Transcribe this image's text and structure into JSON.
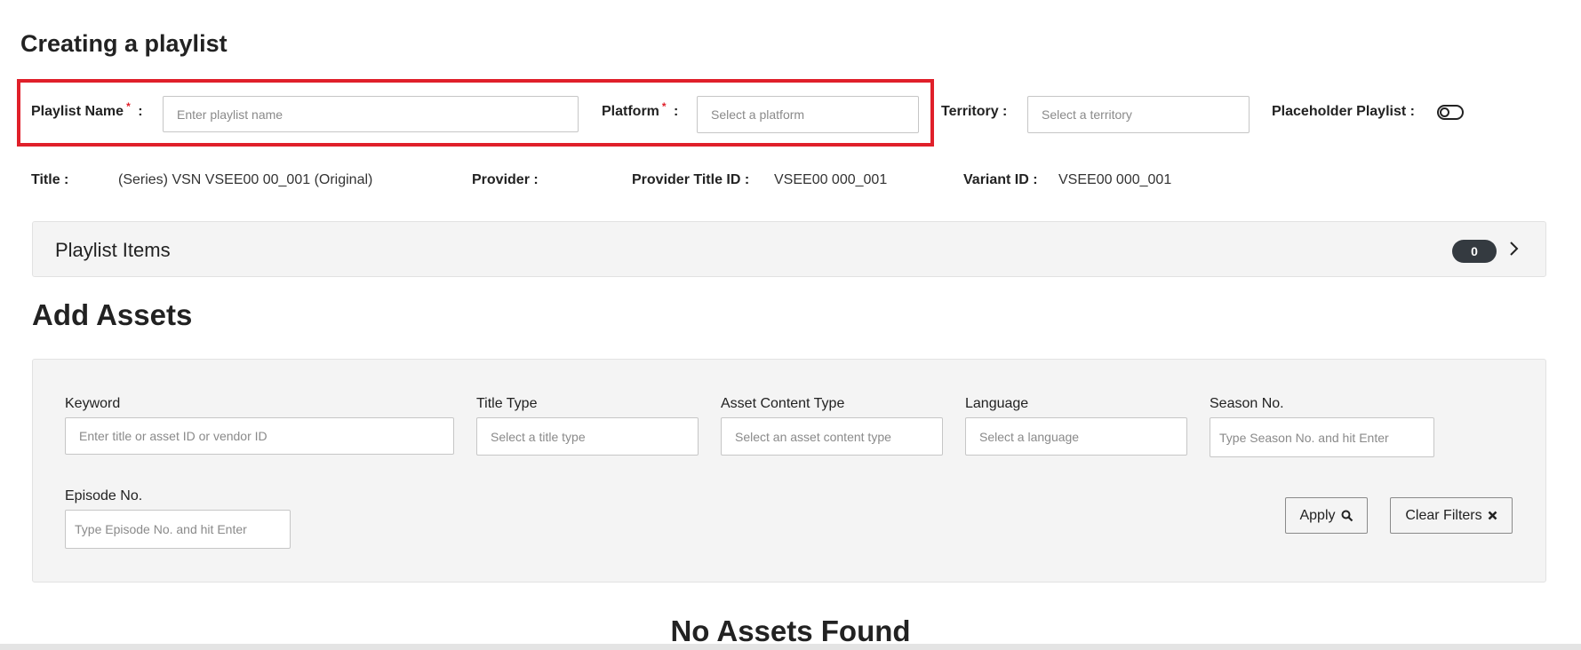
{
  "page": {
    "title": "Creating a playlist"
  },
  "form": {
    "playlist_name": {
      "label": "Playlist Name",
      "required_mark": "*",
      "colon": ":",
      "placeholder": "Enter playlist name"
    },
    "platform": {
      "label": "Platform",
      "required_mark": "*",
      "colon": ":",
      "placeholder": "Select a platform"
    },
    "territory": {
      "label": "Territory :",
      "placeholder": "Select a territory"
    },
    "placeholder_playlist": {
      "label": "Placeholder Playlist :",
      "enabled": false
    }
  },
  "title_info": {
    "title_label": "Title :",
    "title_value": "(Series) VSN VSEE00        00_001 (Original)",
    "provider_label": "Provider :",
    "provider_value": "",
    "provider_title_id_label": "Provider Title ID :",
    "provider_title_id_value": "VSEE00        000_001",
    "variant_id_label": "Variant ID :",
    "variant_id_value": "VSEE00        000_001"
  },
  "playlist_items": {
    "title": "Playlist Items",
    "count": "0"
  },
  "add_assets": {
    "title": "Add Assets",
    "filters": {
      "keyword": {
        "label": "Keyword",
        "placeholder": "Enter title or asset ID or vendor ID"
      },
      "title_type": {
        "label": "Title Type",
        "placeholder": "Select a title type"
      },
      "asset_content_type": {
        "label": "Asset Content Type",
        "placeholder": "Select an asset content type"
      },
      "language": {
        "label": "Language",
        "placeholder": "Select a language"
      },
      "season_no": {
        "label": "Season No.",
        "placeholder": "Type Season No. and hit Enter"
      },
      "episode_no": {
        "label": "Episode No.",
        "placeholder": "Type Episode No. and hit Enter"
      }
    },
    "apply_label": "Apply",
    "clear_filters_label": "Clear Filters",
    "empty_message": "No Assets Found"
  },
  "icons": {
    "apply": "search-icon",
    "clear": "close-icon",
    "expand": "chevron-right-icon"
  },
  "colors": {
    "highlight": "#e0202a",
    "badge": "#343a40",
    "panel": "#f4f4f4"
  }
}
